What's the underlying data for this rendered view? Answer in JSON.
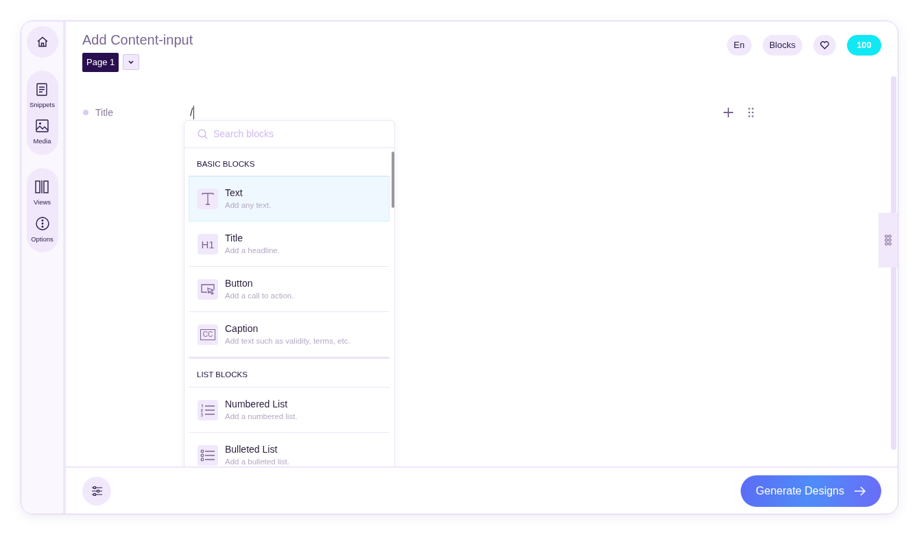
{
  "sidebar": {
    "groups": [
      [
        {
          "kind": "snippets",
          "label": "Snippets"
        },
        {
          "kind": "media",
          "label": "Media"
        }
      ],
      [
        {
          "kind": "views",
          "label": "Views"
        },
        {
          "kind": "options",
          "label": "Options"
        }
      ]
    ]
  },
  "header": {
    "title": "Add Content-input",
    "page": "Page 1",
    "actions": [
      {
        "kind": "text",
        "label": "En"
      },
      {
        "kind": "text",
        "label": "Blocks"
      },
      {
        "kind": "heart"
      },
      {
        "kind": "credits",
        "label": "100"
      }
    ]
  },
  "editor": {
    "field_label": "Title",
    "typed": "/"
  },
  "block_menu": {
    "search": {
      "placeholder": "Search blocks"
    },
    "sections": [
      {
        "title": "BASIC BLOCKS",
        "items": [
          {
            "kind": "text",
            "name": "Text",
            "hint": "Add any text.",
            "selected": true
          },
          {
            "kind": "h1",
            "icon_text": "H1",
            "name": "Title",
            "hint": "Add a headline.",
            "selected": false
          },
          {
            "kind": "button",
            "name": "Button",
            "hint": "Add a call to action.",
            "selected": false
          },
          {
            "kind": "caption",
            "icon_text": "CC",
            "name": "Caption",
            "hint": "Add text such as validity, terms, etc.",
            "selected": false
          }
        ]
      },
      {
        "title": "LIST BLOCKS",
        "items": [
          {
            "kind": "numbered",
            "name": "Numbered List",
            "hint": "Add a numbered list.",
            "selected": false
          },
          {
            "kind": "bulleted",
            "name": "Bulleted List",
            "hint": "Add a bulleted list.",
            "selected": false
          }
        ]
      }
    ]
  },
  "footer": {
    "primary": "Generate Designs"
  }
}
